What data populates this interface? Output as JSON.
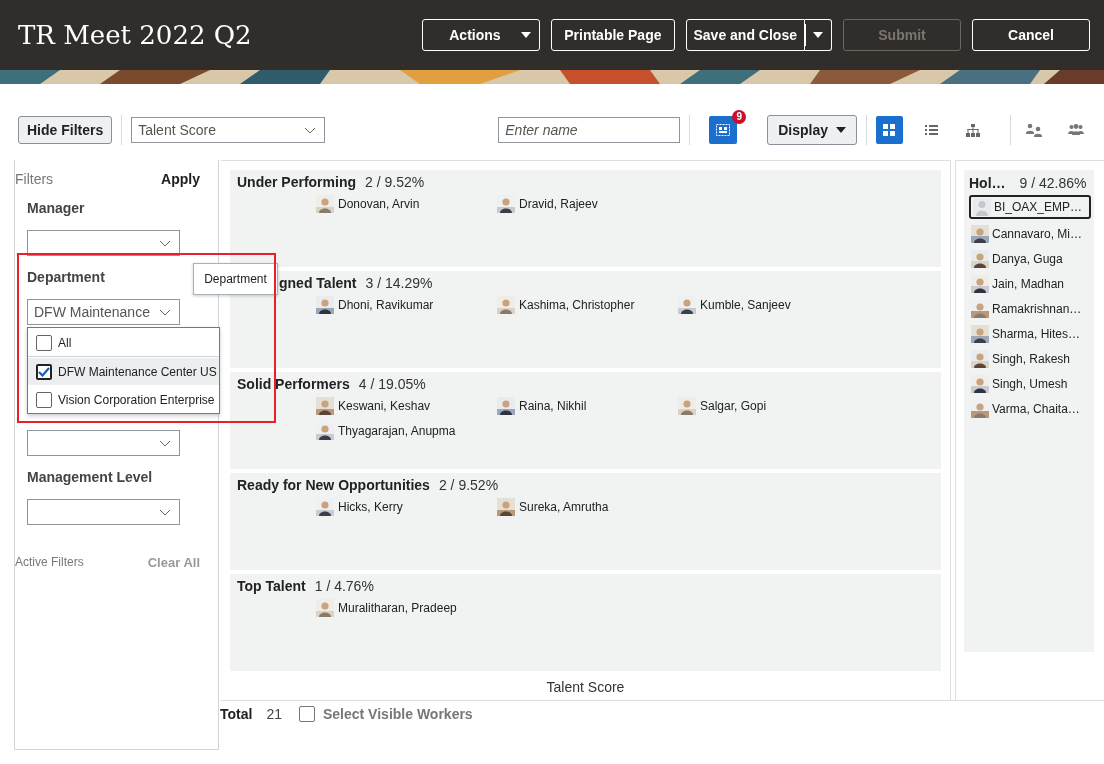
{
  "header": {
    "title": "TR Meet 2022 Q2",
    "buttons": [
      {
        "label": "Actions",
        "kind": "menu",
        "disabled": false
      },
      {
        "label": "Printable Page",
        "kind": "plain",
        "disabled": false
      },
      {
        "label": "Save and Close",
        "kind": "split",
        "disabled": false
      },
      {
        "label": "Submit",
        "kind": "plain",
        "disabled": true
      },
      {
        "label": "Cancel",
        "kind": "plain",
        "disabled": false
      }
    ]
  },
  "toolbar": {
    "hide_filters": "Hide Filters",
    "score_select": "Talent Score",
    "name_search": {
      "placeholder": "Enter name"
    },
    "selection_badge": "9",
    "display": "Display",
    "views": [
      {
        "kind": "grid",
        "selected": true
      },
      {
        "kind": "list",
        "selected": false
      },
      {
        "kind": "hierarchy",
        "selected": false
      }
    ],
    "extra_tools": [
      {
        "kind": "compare"
      },
      {
        "kind": "team"
      }
    ]
  },
  "filters": {
    "title": "Filters",
    "apply": "Apply",
    "fields": [
      {
        "kind": "select",
        "label": "Manager"
      },
      {
        "kind": "select",
        "label": "Department",
        "value": "DFW Maintenance"
      },
      {
        "kind": "select"
      },
      {
        "kind": "select",
        "label": "Management Level"
      }
    ],
    "active_filters": "Active Filters",
    "clear_all": "Clear All",
    "tooltip": "Department",
    "annotation_frame": true,
    "dropdown": {
      "options": [
        {
          "label": "All",
          "checked": false,
          "selected": false
        },
        {
          "label": "DFW Maintenance Center US",
          "checked": true,
          "selected": true
        },
        {
          "label": "Vision Corporation Enterprise",
          "checked": false,
          "selected": false
        }
      ]
    }
  },
  "boxes": [
    {
      "title": "Under Performing",
      "count": "2 / 9.52%",
      "workers": [
        "Donovan, Arvin",
        "Dravid, Rajeev"
      ]
    },
    {
      "title": "gned Talent",
      "partly_hidden": true,
      "count": "3 / 14.29%",
      "workers": [
        "Dhoni, Ravikumar",
        "Kashima, Christopher",
        "Kumble, Sanjeev"
      ]
    },
    {
      "title": "Solid Performers",
      "count": "4 / 19.05%",
      "workers": [
        "Keswani, Keshav",
        "Raina, Nikhil",
        "Salgar, Gopi",
        "Thyagarajan, Anupma"
      ]
    },
    {
      "title": "Ready for New Opportunities",
      "count": "2 / 9.52%",
      "workers": [
        "Hicks, Kerry",
        "Sureka, Amrutha"
      ]
    },
    {
      "title": "Top Talent",
      "count": "1 / 4.76%",
      "workers": [
        "Muralitharan, Pradeep"
      ]
    }
  ],
  "axis_label": "Talent Score",
  "footer": {
    "total_label": "Total",
    "total": "21",
    "select_visible": {
      "label": "Select Visible Workers",
      "checked": false
    }
  },
  "holding": {
    "title": "Hol…",
    "count": "9 / 42.86%",
    "workers": [
      {
        "name": "BI_OAX_EMP…",
        "selected": true,
        "photo": false
      },
      {
        "name": "Cannavaro, Mi…",
        "selected": false,
        "photo": true
      },
      {
        "name": "Danya, Guga",
        "selected": false,
        "photo": true
      },
      {
        "name": "Jain, Madhan",
        "selected": false,
        "photo": true
      },
      {
        "name": "Ramakrishnan…",
        "selected": false,
        "photo": true
      },
      {
        "name": "Sharma, Hites…",
        "selected": false,
        "photo": true
      },
      {
        "name": "Singh, Rakesh",
        "selected": false,
        "photo": true
      },
      {
        "name": "Singh, Umesh",
        "selected": false,
        "photo": true
      },
      {
        "name": "Varma, Chaita…",
        "selected": false,
        "photo": true
      }
    ]
  }
}
